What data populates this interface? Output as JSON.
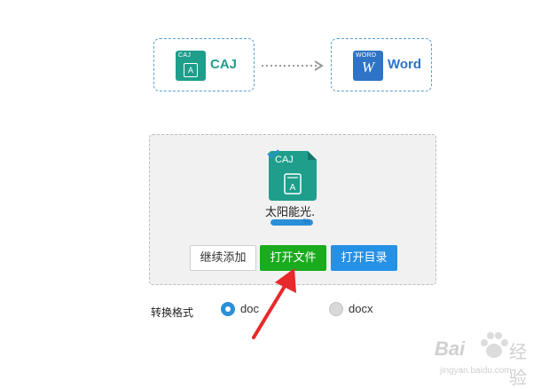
{
  "conversion": {
    "source": {
      "label": "CAJ",
      "icon_tag": "CAJ",
      "icon_glyph": "A",
      "icon": "caj-file-icon",
      "color": "#1f9e8c"
    },
    "target": {
      "label": "Word",
      "icon_tag": "WORD",
      "icon_glyph": "W",
      "icon": "word-file-icon",
      "color": "#2e73c5"
    },
    "arrow_icon": "dotted-right-arrow-icon"
  },
  "file": {
    "icon_tag": "CAJ",
    "name": "太阳能光.",
    "progress_percent": 100,
    "progress_text": "%",
    "check_icon": "checkmark-icon"
  },
  "buttons": {
    "continue_add": "继续添加",
    "open_file": "打开文件",
    "open_directory": "打开目录"
  },
  "format": {
    "label": "转换格式",
    "options": [
      {
        "label": "doc",
        "checked": true
      },
      {
        "label": "docx",
        "checked": false
      }
    ]
  },
  "watermark": {
    "text": "Bai",
    "text2": "经验",
    "url": "jingyan.baidu.com"
  },
  "colors": {
    "accent_blue": "#2490e6",
    "accent_green": "#1aab1e",
    "annotation_red": "#e8282a"
  }
}
